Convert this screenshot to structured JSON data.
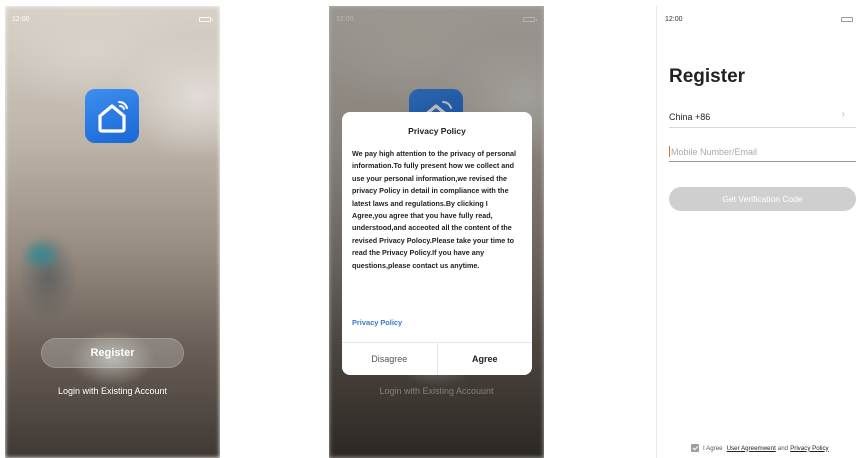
{
  "status": {
    "time": "12:00"
  },
  "welcome": {
    "register_label": "Register",
    "login_label": "Login with Existing Account"
  },
  "privacy": {
    "title": "Privacy Policy",
    "body": "We pay high attention to the privacy of personal information.To fully present how we collect and use your personal information,we revised the privacy Policy in detail in compliance with the latest laws and regulations.By clicking I Agree,you agree that you have fully read, understood,and acceoted all the content of the revised Privacy Polocy.Please take your time to read the Privacy Policy.If you have any questions,please contact us anytime.",
    "link_label": "Privacy Policy",
    "disagree_label": "Disagree",
    "agree_label": "Agree",
    "behind_login_label": "Login with Existing Accouunt"
  },
  "register_form": {
    "title": "Register",
    "country": "China +86",
    "phone_placeholder": "Mobile Number/Email",
    "get_code_label": "Get Verification Code",
    "agree_prefix": "I Agree",
    "user_agreement": "User Agreemwent",
    "and_text": "and",
    "privacy_policy": "Privacy Policy"
  },
  "colors": {
    "app_icon_blue": "#2a7be4",
    "link_blue": "#3c79c8",
    "disabled_button": "#cfcfcf"
  },
  "icons": {
    "app": "smart-home-icon",
    "chevron": "chevron-right-icon",
    "battery": "battery-icon",
    "checkbox": "checkbox-checked-icon"
  }
}
